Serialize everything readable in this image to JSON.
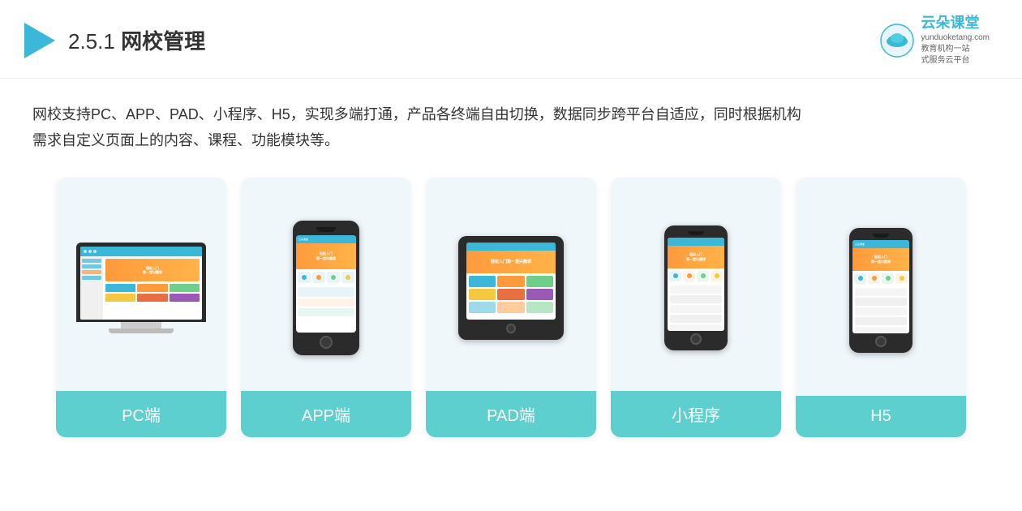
{
  "header": {
    "section_number": "2.5.1",
    "title_plain": "",
    "title_bold": "网校管理",
    "brand_name": "云朵课堂",
    "brand_url": "yunduoketang.com",
    "brand_tagline1": "教育机构一站",
    "brand_tagline2": "式服务云平台"
  },
  "description": {
    "line1": "网校支持PC、APP、PAD、小程序、H5，实现多端打通，产品各终端自由切换，数据同步跨平台自适应，同时根据机构",
    "line2": "需求自定义页面上的内容、课程、功能模块等。"
  },
  "cards": [
    {
      "id": "pc",
      "label": "PC端"
    },
    {
      "id": "app",
      "label": "APP端"
    },
    {
      "id": "pad",
      "label": "PAD端"
    },
    {
      "id": "miniprogram",
      "label": "小程序"
    },
    {
      "id": "h5",
      "label": "H5"
    }
  ]
}
